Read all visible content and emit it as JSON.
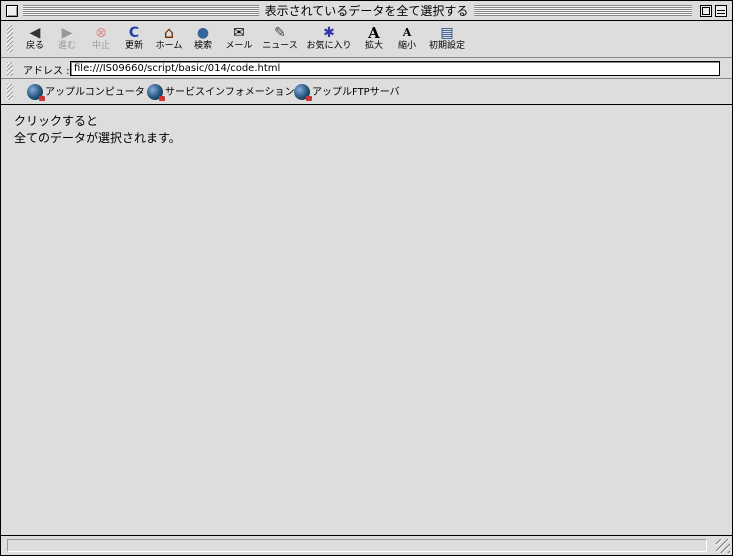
{
  "window": {
    "title": "表示されているデータを全て選択する"
  },
  "toolbar": {
    "buttons": [
      {
        "label": "戻る",
        "icon": "back-arrow",
        "glyph": "◆",
        "color": "#333333",
        "enabled": true
      },
      {
        "label": "進む",
        "icon": "forward-arrow",
        "glyph": "◆",
        "color": "#999999",
        "enabled": false
      },
      {
        "label": "中止",
        "icon": "stop",
        "glyph": "⊗",
        "color": "#d88888",
        "enabled": false
      },
      {
        "label": "更新",
        "icon": "refresh",
        "glyph": "C",
        "color": "#2244aa",
        "enabled": true
      },
      {
        "label": "ホーム",
        "icon": "home",
        "glyph": "⌂",
        "color": "#6a2a00",
        "enabled": true
      },
      {
        "label": "検索",
        "icon": "search-globe",
        "glyph": "●",
        "color": "#336699",
        "enabled": true
      },
      {
        "label": "メール",
        "icon": "mail",
        "glyph": "✉",
        "color": "#222222",
        "enabled": true
      },
      {
        "label": "ニュース",
        "icon": "news",
        "glyph": "✎",
        "color": "#444444",
        "enabled": true
      },
      {
        "label": "お気に入り",
        "icon": "favorites-folder",
        "glyph": "✱",
        "color": "#3333aa",
        "enabled": true
      },
      {
        "label": "拡大",
        "icon": "text-larger",
        "glyph": "A",
        "color": "#000000",
        "enabled": true
      },
      {
        "label": "縮小",
        "icon": "text-smaller",
        "glyph": "A",
        "color": "#000000",
        "enabled": true
      },
      {
        "label": "初期設定",
        "icon": "preferences",
        "glyph": "▤",
        "color": "#224488",
        "enabled": true
      }
    ]
  },
  "address": {
    "label": "アドレス :",
    "value": "file:///IS09660/script/basic/014/code.html"
  },
  "favorites": [
    {
      "label": "アップルコンピュータ"
    },
    {
      "label": "サービスインフォメーション"
    },
    {
      "label": "アップルFTPサーバ"
    }
  ],
  "content": {
    "line1": "クリックすると",
    "line2": "全てのデータが選択されます。"
  },
  "status": {
    "text": ""
  }
}
